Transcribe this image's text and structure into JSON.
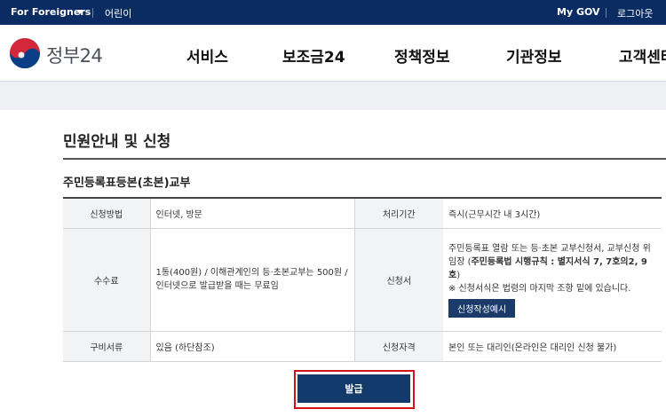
{
  "topbar": {
    "foreigners": "For Foreigners",
    "kids": "어린이",
    "my_gov": "My GOV",
    "logout": "로그아웃"
  },
  "header": {
    "logo_text": "정부24",
    "nav": [
      "서비스",
      "보조금24",
      "정책정보",
      "기관정보",
      "고객센터"
    ]
  },
  "main": {
    "page_title": "민원안내 및 신청",
    "service_name": "주민등록표등본(초본)교부",
    "table": {
      "method_label": "신청방법",
      "method_value": "인터넷, 방문",
      "period_label": "처리기간",
      "period_value": "즉시(근무시간 내 3시간)",
      "fee_label": "수수료",
      "fee_value": "1통(400원) / 이해관계인의 등·초본교부는 500원 / 인터넷으로 발급받을 때는 무료임",
      "form_label": "신청서",
      "form_value_1": "주민등록표 열람 또는 등·초본 교부신청서, 교부신청 위임장 (",
      "form_value_bold": "주민등록법 시행규칙 : 별지서식 7, 7호의2, 9호",
      "form_value_2": ")",
      "form_note": "※ 신청서식은 법령의 마지막 조항 밑에 있습니다.",
      "form_example_button": "신청작성예시",
      "docs_label": "구비서류",
      "docs_value": "있음 (하단참조)",
      "qual_label": "신청자격",
      "qual_value": "본인 또는 대리인(온라인은 대리인 신청 불가)"
    },
    "issue_button": "발급"
  },
  "colors": {
    "topbar_bg": "#0b2c62",
    "button_bg": "#123a6a",
    "highlight_border": "#d0141c"
  }
}
